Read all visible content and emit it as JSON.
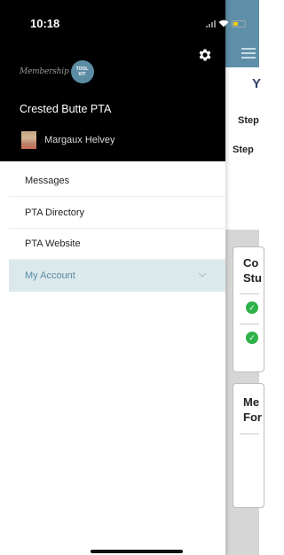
{
  "status_bar": {
    "time": "10:18"
  },
  "drawer": {
    "logo_text": "Membership",
    "logo_badge": [
      "TOOL",
      "KIT"
    ],
    "org_name": "Crested Butte PTA",
    "user_name": "Margaux Helvey",
    "menu": [
      {
        "label": "Messages"
      },
      {
        "label": "PTA Directory"
      },
      {
        "label": "PTA Website"
      },
      {
        "label": "My Account",
        "active": true
      }
    ]
  },
  "background_page": {
    "heading": "Y",
    "step_1": "Step",
    "step_2": "Step",
    "card_1_title": [
      "Co",
      "Stu"
    ],
    "card_2_title": [
      "Me",
      "For"
    ]
  },
  "colors": {
    "header_bg": "#000000",
    "accent": "#5b8ca4",
    "active_item_bg": "#dbe8ec",
    "check_green": "#2eb24a"
  }
}
